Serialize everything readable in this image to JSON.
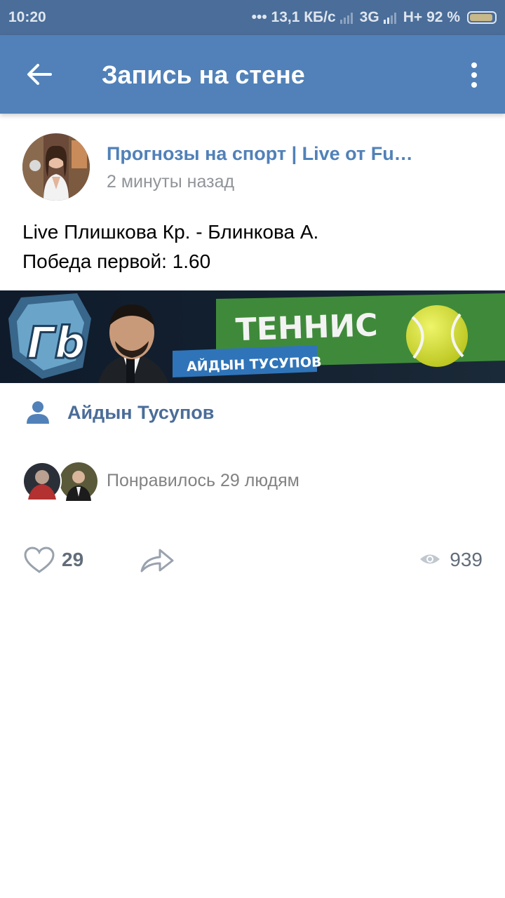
{
  "status_bar": {
    "time": "10:20",
    "indicators": "••• 13,1 КБ/с",
    "network_3g": "3G",
    "network_hplus": "H+",
    "battery": "92 %"
  },
  "app_bar": {
    "title": "Запись на стене",
    "back_icon": "arrow-left-icon",
    "menu_icon": "more-vertical-icon"
  },
  "post": {
    "author": "Прогнозы на спорт | Live от Fu…",
    "time": "2 минуты назад",
    "text_line1": "Live Плишкова Кр. - Блинкова А.",
    "text_line2": "Победа первой: 1.60",
    "banner": {
      "logo": "Гb",
      "headline": "ТЕННИС",
      "caption": "АЙДЫН ТУСУПОВ"
    },
    "signer": "Айдын Тусупов",
    "liked_by": "Понравилось 29 людям",
    "likes": "29",
    "views": "939"
  },
  "colors": {
    "status_bar": "#4a6d99",
    "app_bar": "#5181b8",
    "link": "#5181b8",
    "secondary_text": "#909499"
  }
}
